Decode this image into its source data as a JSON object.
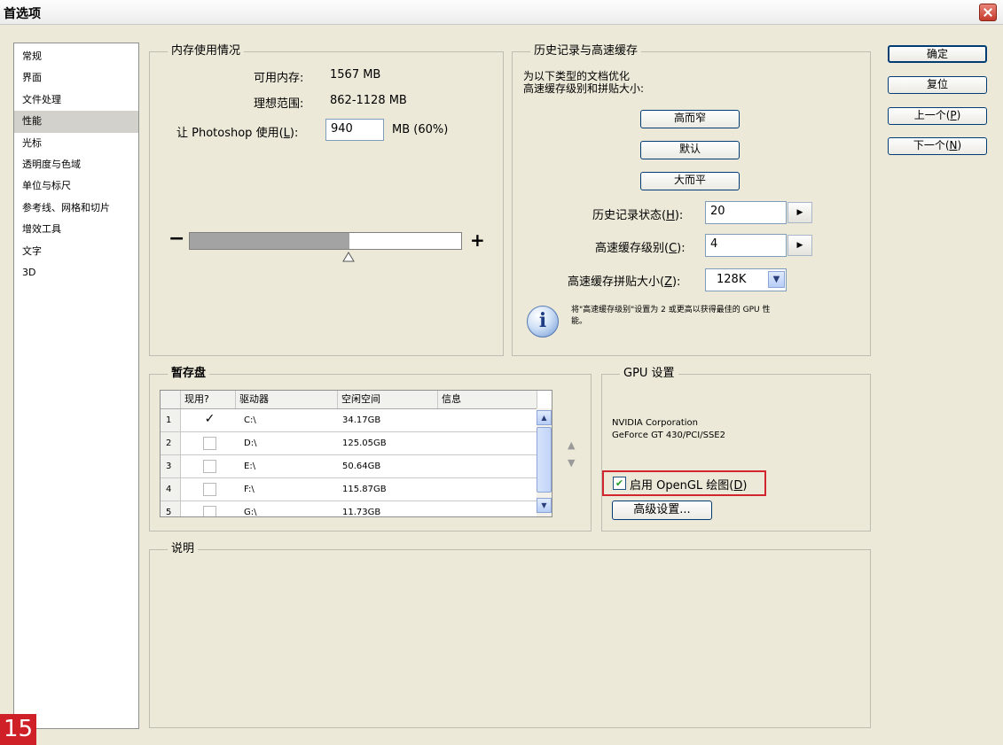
{
  "window": {
    "title": "首选项"
  },
  "sidebar": {
    "items": [
      "常规",
      "界面",
      "文件处理",
      "性能",
      "光标",
      "透明度与色域",
      "单位与标尺",
      "参考线、网格和切片",
      "增效工具",
      "文字",
      "3D"
    ],
    "selected_index": 3
  },
  "memory": {
    "legend": "内存使用情况",
    "available_label": "可用内存:",
    "available_value": "1567 MB",
    "ideal_label": "理想范围:",
    "ideal_value": "862-1128 MB",
    "use_label_prefix": "让 Photoshop 使用(",
    "use_label_key": "L",
    "use_label_suffix": "):",
    "use_value": "940",
    "use_unit": "MB (60%)",
    "slider_minus": "−",
    "slider_plus": "+",
    "slider_fraction": 0.6
  },
  "history": {
    "legend": "历史记录与高速缓存",
    "desc_line1": "为以下类型的文档优化",
    "desc_line2": "高速缓存级别和拼贴大小:",
    "btn_tall": "高而窄",
    "btn_default": "默认",
    "btn_wide": "大而平",
    "states_prefix": "历史记录状态(",
    "states_key": "H",
    "states_suffix": "):",
    "states_value": "20",
    "cache_levels_prefix": "高速缓存级别(",
    "cache_levels_key": "C",
    "cache_levels_suffix": "):",
    "cache_levels_value": "4",
    "tile_prefix": "高速缓存拼贴大小(",
    "tile_key": "Z",
    "tile_suffix": "):",
    "tile_value": "128K",
    "tip_line1": "将\"高速缓存级别\"设置为 2 或更高以获得最佳的 GPU 性",
    "tip_line2": "能。"
  },
  "scratch": {
    "legend": "暂存盘",
    "columns": [
      "现用?",
      "驱动器",
      "空闲空间",
      "信息"
    ],
    "rows": [
      {
        "num": "1",
        "active": "✓",
        "drive": "C:\\",
        "free": "34.17GB"
      },
      {
        "num": "2",
        "active": "",
        "drive": "D:\\",
        "free": "125.05GB"
      },
      {
        "num": "3",
        "active": "",
        "drive": "E:\\",
        "free": "50.64GB"
      },
      {
        "num": "4",
        "active": "",
        "drive": "F:\\",
        "free": "115.87GB"
      },
      {
        "num": "5",
        "active": "",
        "drive": "G:\\",
        "free": "11.73GB"
      }
    ]
  },
  "gpu": {
    "legend": "GPU 设置",
    "vendor": "NVIDIA Corporation",
    "model": "GeForce GT 430/PCI/SSE2",
    "opengl_prefix": "启用 OpenGL 绘图(",
    "opengl_key": "D",
    "opengl_suffix": ")",
    "advanced": "高级设置..."
  },
  "description": {
    "legend": "说明"
  },
  "actions": {
    "ok": "确定",
    "reset": "复位",
    "prev_prefix": "上一个(",
    "prev_key": "P",
    "prev_suffix": ")",
    "next_prefix": "下一个(",
    "next_key": "N",
    "next_suffix": ")"
  },
  "step_badge": "15",
  "colors": {
    "highlight": "#d2262e",
    "dialog_bg": "#ece9d8"
  }
}
